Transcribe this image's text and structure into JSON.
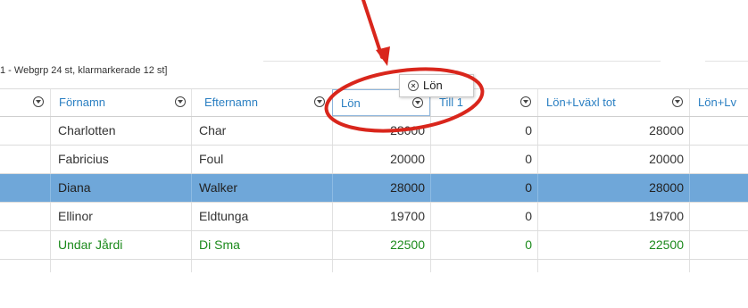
{
  "group_label": "1 - Webgrp 24 st, klarmarkerade 12 st]",
  "columns": [
    {
      "label": ""
    },
    {
      "label": "Förnamn"
    },
    {
      "label": "Efternamn"
    },
    {
      "label": "Lön"
    },
    {
      "label": "Till 1"
    },
    {
      "label": "Lön+Lväxl tot"
    },
    {
      "label": "Lön+Lv"
    }
  ],
  "rows": [
    {
      "fornamn": "Charlotten",
      "efternamn": "Char",
      "lon": "28000",
      "till1": "0",
      "tot": "28000",
      "state": "normal"
    },
    {
      "fornamn": "Fabricius",
      "efternamn": "Foul",
      "lon": "20000",
      "till1": "0",
      "tot": "20000",
      "state": "normal"
    },
    {
      "fornamn": "Diana",
      "efternamn": "Walker",
      "lon": "28000",
      "till1": "0",
      "tot": "28000",
      "state": "selected"
    },
    {
      "fornamn": "Ellinor",
      "efternamn": "Eldtunga",
      "lon": "19700",
      "till1": "0",
      "tot": "19700",
      "state": "normal"
    },
    {
      "fornamn": "Undar Jårdi",
      "efternamn": "Di Sma",
      "lon": "22500",
      "till1": "0",
      "tot": "22500",
      "state": "green"
    }
  ],
  "drag_tooltip": {
    "label": "Lön",
    "icon": "remove-circle-icon"
  },
  "colors": {
    "header_text": "#2a7fc2",
    "selected_row": "#6fa7d9",
    "green_text": "#1c8a1c",
    "annotation": "#d9261c"
  }
}
